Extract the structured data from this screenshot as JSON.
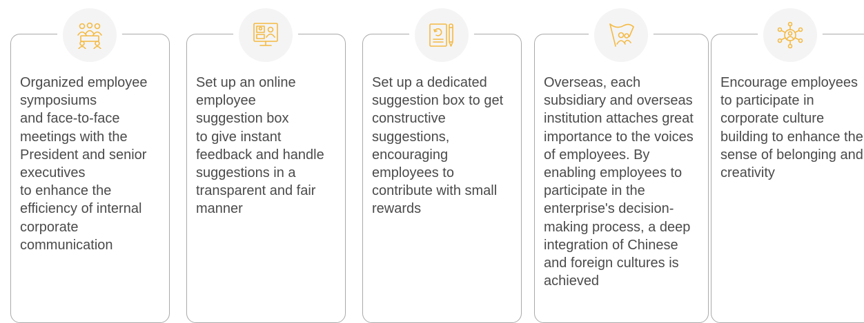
{
  "accent_color": "#f4b942",
  "cards": [
    {
      "icon": "meeting-icon",
      "text": "Organized employee symposiums\nand face-to-face meetings with the President and senior executives\nto enhance the efficiency of internal corporate communication"
    },
    {
      "icon": "online-suggestion-icon",
      "text": "Set up an online employee\nsuggestion box\nto give instant feedback and handle suggestions in a transparent and fair manner"
    },
    {
      "icon": "suggestion-box-icon",
      "text": "Set up a dedicated suggestion box to get constructive suggestions, encouraging employees to contribute with small rewards"
    },
    {
      "icon": "flag-people-icon",
      "text": "Overseas, each subsidiary and overseas institution attaches great importance to the voices of employees. By enabling employees to participate in the enterprise's decision-making process, a deep integration of Chinese and foreign cultures is achieved"
    },
    {
      "icon": "network-people-icon",
      "text": "Encourage employees to participate in corporate culture building to enhance their sense of belonging and creativity"
    }
  ]
}
